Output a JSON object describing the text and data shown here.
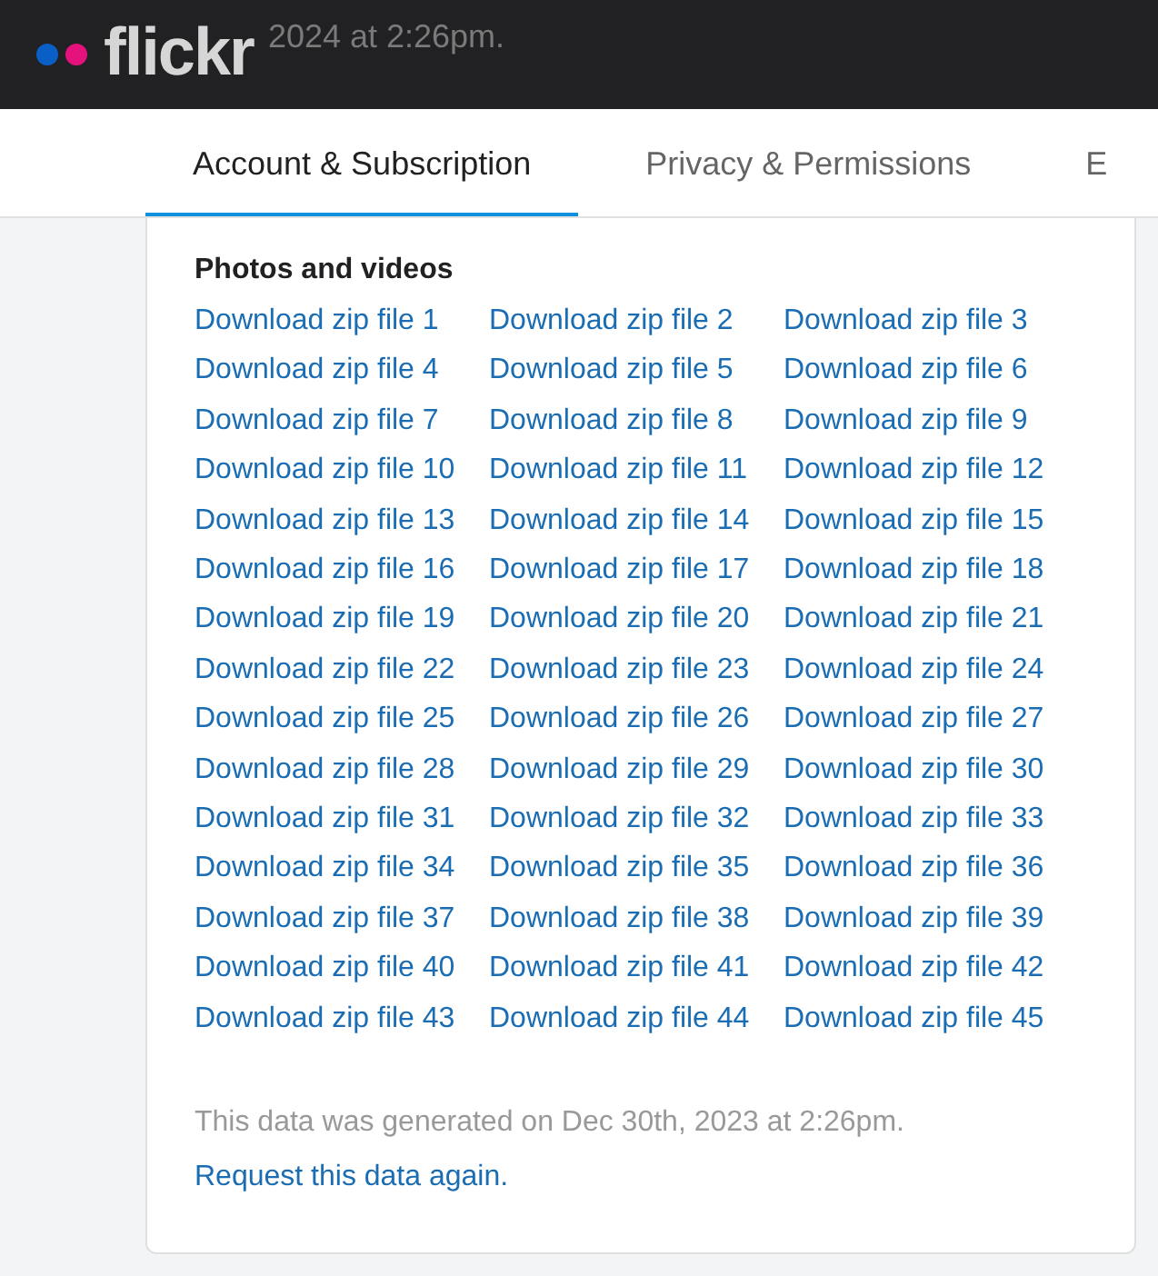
{
  "header": {
    "logo": "flickr",
    "faded_text": "2024 at 2:26pm."
  },
  "tabs": [
    {
      "label": "Account & Subscription",
      "selected": true
    },
    {
      "label": "Privacy & Permissions",
      "selected": false
    },
    {
      "label": "E",
      "selected": false
    }
  ],
  "section": {
    "heading": "Photos and videos",
    "links": [
      "Download zip file 1",
      "Download zip file 2",
      "Download zip file 3",
      "Download zip file 4",
      "Download zip file 5",
      "Download zip file 6",
      "Download zip file 7",
      "Download zip file 8",
      "Download zip file 9",
      "Download zip file 10",
      "Download zip file 11",
      "Download zip file 12",
      "Download zip file 13",
      "Download zip file 14",
      "Download zip file 15",
      "Download zip file 16",
      "Download zip file 17",
      "Download zip file 18",
      "Download zip file 19",
      "Download zip file 20",
      "Download zip file 21",
      "Download zip file 22",
      "Download zip file 23",
      "Download zip file 24",
      "Download zip file 25",
      "Download zip file 26",
      "Download zip file 27",
      "Download zip file 28",
      "Download zip file 29",
      "Download zip file 30",
      "Download zip file 31",
      "Download zip file 32",
      "Download zip file 33",
      "Download zip file 34",
      "Download zip file 35",
      "Download zip file 36",
      "Download zip file 37",
      "Download zip file 38",
      "Download zip file 39",
      "Download zip file 40",
      "Download zip file 41",
      "Download zip file 42",
      "Download zip file 43",
      "Download zip file 44",
      "Download zip file 45"
    ]
  },
  "footer": {
    "text": "This data was generated on Dec 30th, 2023 at 2:26pm.",
    "link": "Request this data again."
  }
}
